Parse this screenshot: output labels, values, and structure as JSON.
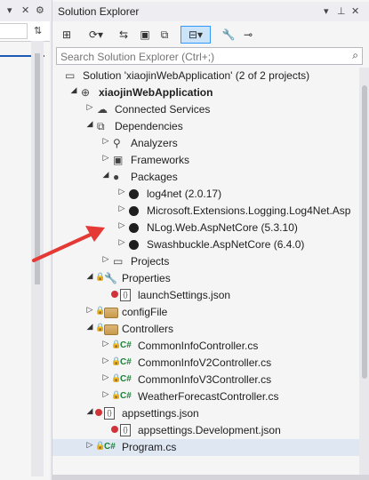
{
  "left_strip": {
    "title_glyphs": [
      "▾",
      "✕",
      "⚙"
    ],
    "splitter_glyph": "⇅"
  },
  "panel": {
    "title": "Solution Explorer",
    "title_buttons": [
      "▾",
      "⊥",
      "✕"
    ],
    "toolbar": [
      "⊞",
      "⟳▾",
      "⇆",
      "▣",
      "⧉",
      "⊟▾",
      "🔧",
      "⊸"
    ],
    "search": {
      "placeholder": "Search Solution Explorer (Ctrl+;)",
      "value": "",
      "icon": "search-icon"
    }
  },
  "tree": [
    {
      "label": "Solution 'xiaojinWebApplication' (2 of 2 projects)",
      "icon": "solution",
      "level": 0,
      "arrow": ""
    },
    {
      "label": "xiaojinWebApplication",
      "icon": "project",
      "level": 1,
      "arrow": "◢",
      "bold": true
    },
    {
      "label": "Connected Services",
      "icon": "connected-services",
      "level": 2,
      "arrow": "▷"
    },
    {
      "label": "Dependencies",
      "icon": "dependencies",
      "level": 2,
      "arrow": "◢"
    },
    {
      "label": "Analyzers",
      "icon": "analyzers",
      "level": 3,
      "arrow": "▷"
    },
    {
      "label": "Frameworks",
      "icon": "frameworks",
      "level": 3,
      "arrow": "▷"
    },
    {
      "label": "Packages",
      "icon": "packages",
      "level": 3,
      "arrow": "◢"
    },
    {
      "label": "log4net (2.0.17)",
      "icon": "package",
      "level": 4,
      "arrow": "▷"
    },
    {
      "label": "Microsoft.Extensions.Logging.Log4Net.Asp",
      "icon": "package",
      "level": 4,
      "arrow": "▷"
    },
    {
      "label": "NLog.Web.AspNetCore (5.3.10)",
      "icon": "package",
      "level": 4,
      "arrow": "▷"
    },
    {
      "label": "Swashbuckle.AspNetCore (6.4.0)",
      "icon": "package",
      "level": 4,
      "arrow": "▷"
    },
    {
      "label": "Projects",
      "icon": "projects",
      "level": 3,
      "arrow": "▷"
    },
    {
      "label": "Properties",
      "icon": "properties",
      "level": 2,
      "arrow": "◢",
      "lock": true
    },
    {
      "label": "launchSettings.json",
      "icon": "json",
      "level": 3,
      "arrow": "",
      "warn": true
    },
    {
      "label": "configFile",
      "icon": "folder",
      "level": 2,
      "arrow": "▷",
      "lock": true
    },
    {
      "label": "Controllers",
      "icon": "folder",
      "level": 2,
      "arrow": "◢",
      "lock": true
    },
    {
      "label": "CommonInfoController.cs",
      "icon": "cs",
      "level": 3,
      "arrow": "▷",
      "lock": true
    },
    {
      "label": "CommonInfoV2Controller.cs",
      "icon": "cs",
      "level": 3,
      "arrow": "▷",
      "lock": true
    },
    {
      "label": "CommonInfoV3Controller.cs",
      "icon": "cs",
      "level": 3,
      "arrow": "▷",
      "lock": true
    },
    {
      "label": "WeatherForecastController.cs",
      "icon": "cs",
      "level": 3,
      "arrow": "▷",
      "lock": true
    },
    {
      "label": "appsettings.json",
      "icon": "json",
      "level": 2,
      "arrow": "◢",
      "warn": true
    },
    {
      "label": "appsettings.Development.json",
      "icon": "json",
      "level": 3,
      "arrow": "",
      "warn": true
    },
    {
      "label": "Program.cs",
      "icon": "cs",
      "level": 2,
      "arrow": "▷",
      "lock": true,
      "selected": true
    }
  ],
  "colors": {
    "accent": "#3399ff",
    "selection": "#dfe7f3",
    "annotation_arrow": "#e53935"
  }
}
